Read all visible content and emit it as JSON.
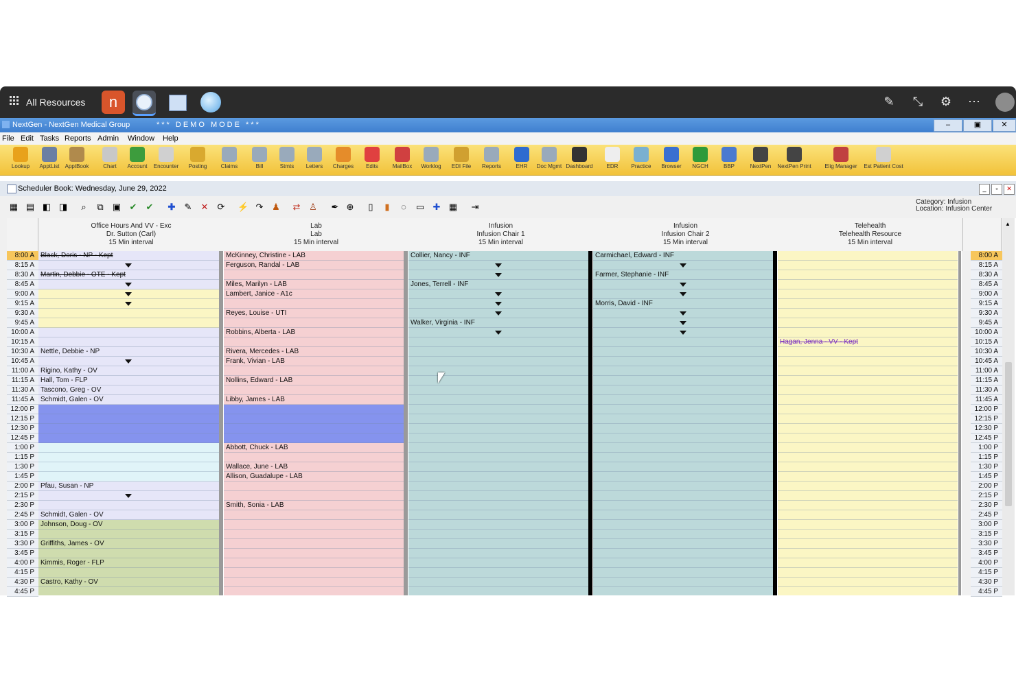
{
  "top_bar": {
    "all_resources": "All Resources",
    "apps": [
      "nextgen-app-icon",
      "globe-app-icon",
      "calendar-app-icon",
      "earth-app-icon"
    ]
  },
  "title_bar": {
    "title": "NextGen - NextGen Medical Group",
    "mode": "*** DEMO MODE ***"
  },
  "menu": [
    "File",
    "Edit",
    "Tasks",
    "Reports",
    "Admin",
    "Window",
    "Help"
  ],
  "toolbar": [
    "Lookup",
    "ApptList",
    "ApptBook",
    "Chart",
    "Account",
    "Encounter",
    "Posting",
    "Claims",
    "Bill",
    "Stmts",
    "Letters",
    "Charges",
    "Edits",
    "MailBox",
    "Worklog",
    "EDI File",
    "Reports",
    "EHR",
    "Doc Mgmt",
    "Dashboard",
    "EDR",
    "Practice",
    "Browser",
    "NGCH",
    "BBP",
    "NextPen",
    "NextPen Print",
    "Elig Manager",
    "Est Patient Cost"
  ],
  "panel": {
    "title": "Scheduler Book: Wednesday, June 29, 2022",
    "category": "Category: Infusion",
    "location": "Location: Infusion Center"
  },
  "times": [
    "8:00 A",
    "8:15 A",
    "8:30 A",
    "8:45 A",
    "9:00 A",
    "9:15 A",
    "9:30 A",
    "9:45 A",
    "10:00 A",
    "10:15 A",
    "10:30 A",
    "10:45 A",
    "11:00 A",
    "11:15 A",
    "11:30 A",
    "11:45 A",
    "12:00 P",
    "12:15 P",
    "12:30 P",
    "12:45 P",
    "1:00 P",
    "1:15 P",
    "1:30 P",
    "1:45 P",
    "2:00 P",
    "2:15 P",
    "2:30 P",
    "2:45 P",
    "3:00 P",
    "3:15 P",
    "3:30 P",
    "3:45 P",
    "4:00 P",
    "4:15 P",
    "4:30 P",
    "4:45 P"
  ],
  "columns": [
    {
      "header": [
        "Office Hours And VV - Exc",
        "Dr. Sutton (Carl)",
        "15 Min interval"
      ],
      "bg": "#e6e6f8",
      "appointments": [
        {
          "slot": 0,
          "text": "Black, Doris - NP - Kept",
          "kept": true
        },
        {
          "slot": 2,
          "text": "Martin, Debbie - OTE - Kept",
          "kept": true
        },
        {
          "slot": 10,
          "text": "Nettle, Debbie - NP"
        },
        {
          "slot": 12,
          "text": "Rigino, Kathy - OV"
        },
        {
          "slot": 13,
          "text": "Hall, Tom - FLP"
        },
        {
          "slot": 14,
          "text": "Tascono, Greg - OV"
        },
        {
          "slot": 15,
          "text": "Schmidt, Galen - OV"
        },
        {
          "slot": 24,
          "text": "Pfau, Susan - NP"
        },
        {
          "slot": 27,
          "text": "Schmidt, Galen - OV"
        },
        {
          "slot": 28,
          "text": "Johnson, Doug - OV"
        },
        {
          "slot": 30,
          "text": "Griffiths, James - OV"
        },
        {
          "slot": 32,
          "text": "Kimmis, Roger - FLP"
        },
        {
          "slot": 34,
          "text": "Castro, Kathy - OV"
        }
      ]
    },
    {
      "header": [
        "Lab",
        "Lab",
        "15 Min interval"
      ],
      "bg": "#f5d0d2",
      "appointments": [
        {
          "slot": 0,
          "text": "McKinney, Christine - LAB"
        },
        {
          "slot": 1,
          "text": "Ferguson, Randal - LAB"
        },
        {
          "slot": 3,
          "text": "Miles, Marilyn - LAB"
        },
        {
          "slot": 4,
          "text": "Lambert, Janice - A1c"
        },
        {
          "slot": 6,
          "text": "Reyes, Louise - UTI"
        },
        {
          "slot": 8,
          "text": "Robbins, Alberta - LAB"
        },
        {
          "slot": 10,
          "text": "Rivera, Mercedes - LAB"
        },
        {
          "slot": 11,
          "text": "Frank, Vivian - LAB"
        },
        {
          "slot": 13,
          "text": "Nollins, Edward - LAB"
        },
        {
          "slot": 15,
          "text": "Libby, James - LAB"
        },
        {
          "slot": 20,
          "text": "Abbott, Chuck - LAB"
        },
        {
          "slot": 22,
          "text": "Wallace, June - LAB"
        },
        {
          "slot": 23,
          "text": "Allison, Guadalupe - LAB"
        },
        {
          "slot": 26,
          "text": "Smith, Sonia - LAB"
        }
      ]
    },
    {
      "header": [
        "Infusion",
        "Infusion Chair 1",
        "15 Min interval"
      ],
      "bg": "#bcd9da",
      "appointments": [
        {
          "slot": 0,
          "text": "Collier, Nancy - INF"
        },
        {
          "slot": 3,
          "text": "Jones, Terrell - INF"
        },
        {
          "slot": 7,
          "text": "Walker, Virginia - INF"
        }
      ]
    },
    {
      "header": [
        "Infusion",
        "Infusion Chair 2",
        "15 Min interval"
      ],
      "bg": "#bcd9da",
      "appointments": [
        {
          "slot": 0,
          "text": "Carmichael, Edward - INF"
        },
        {
          "slot": 2,
          "text": "Farmer, Stephanie - INF"
        },
        {
          "slot": 5,
          "text": "Morris, David - INF"
        }
      ]
    },
    {
      "header": [
        "Telehealth",
        "Telehealth Resource",
        "15 Min interval"
      ],
      "bg": "#fbf6c4",
      "appointments": [
        {
          "slot": 9,
          "text": "Hagan, Jenna - VV - Kept",
          "kept": true,
          "color": "#7a2fc0"
        }
      ]
    }
  ]
}
